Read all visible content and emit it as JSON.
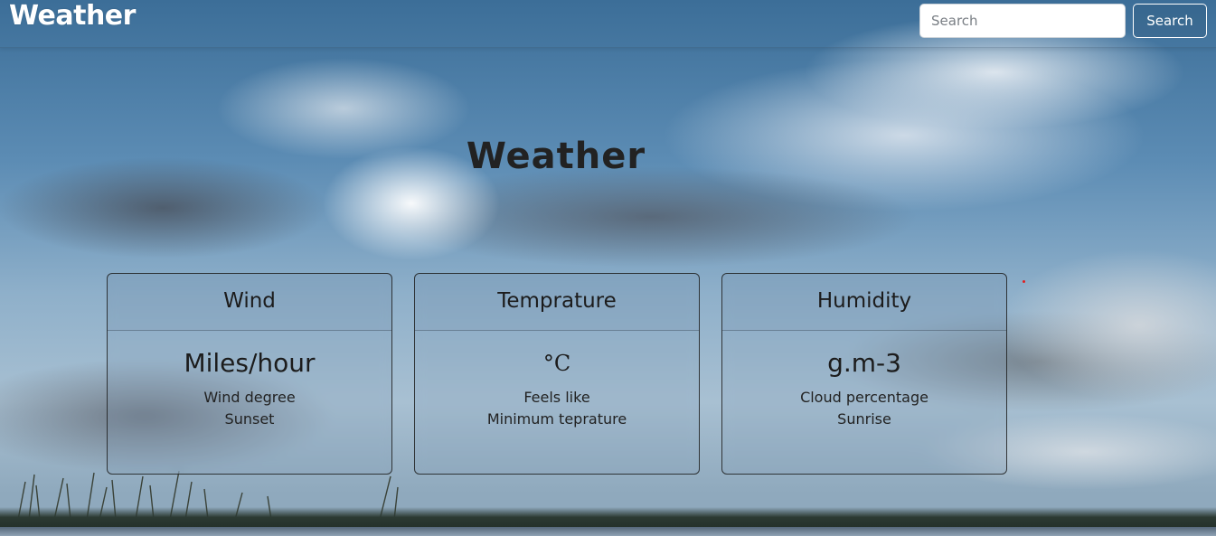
{
  "navbar": {
    "brand": "Weather",
    "search_placeholder": "Search",
    "search_value": "",
    "search_button_label": "Search"
  },
  "main": {
    "title": "Weather",
    "cards": [
      {
        "header": "Wind",
        "primary": "Miles/hour",
        "lines": [
          "Wind degree",
          "Sunset"
        ]
      },
      {
        "header": "Temprature",
        "primary": "°C",
        "lines": [
          "Feels like",
          "Minimum teprature"
        ]
      },
      {
        "header": "Humidity",
        "primary": "g.m-3",
        "lines": [
          "Cloud percentage",
          "Sunrise"
        ]
      }
    ]
  },
  "colors": {
    "sky_top": "#3c6e98",
    "title_text": "#222222",
    "brand_text": "#ffffff",
    "card_border": "#1e1e1e"
  }
}
